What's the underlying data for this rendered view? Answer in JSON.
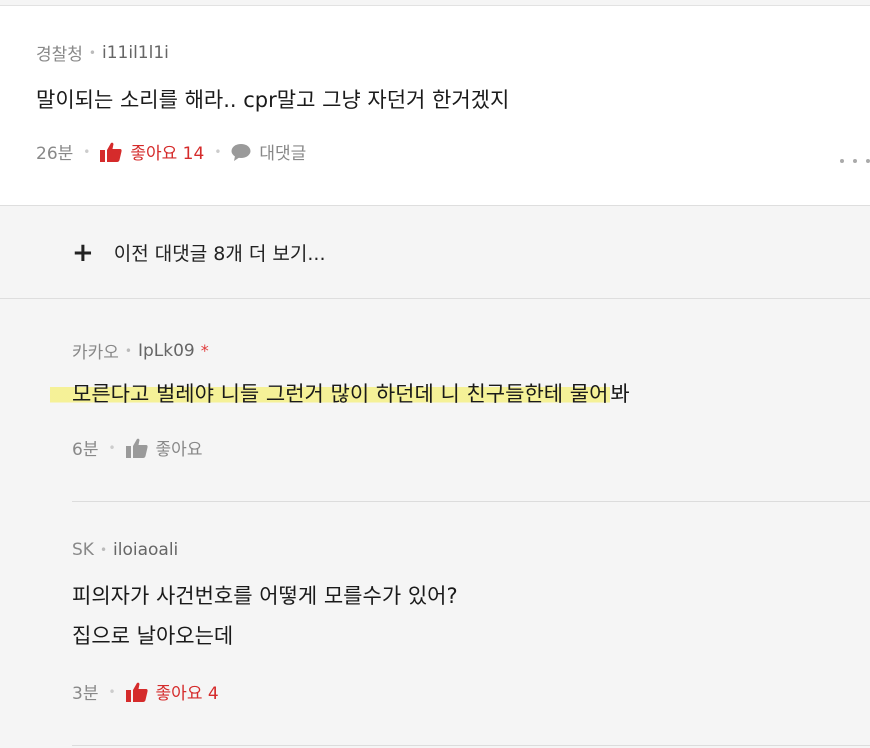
{
  "comment": {
    "source": "경찰청",
    "user": "i11il1l1i",
    "text": "말이되는 소리를 해라.. cpr말고 그냥 자던거 한거겠지",
    "time": "26분",
    "like_label": "좋아요 14",
    "reply_label": "대댓글"
  },
  "more_replies": {
    "label": "이전 대댓글 8개 더 보기..."
  },
  "replies": [
    {
      "source": "카카오",
      "user": "IpLk09",
      "badge": "*",
      "text_highlighted": "모른다고 벌레야 니들 그런거 많이 하던데 니 친구들한테 물어",
      "text_rest": "봐",
      "time": "6분",
      "like_label": "좋아요"
    },
    {
      "source": "SK",
      "user": "iloiaoali",
      "lines": [
        "피의자가 사건번호를 어떻게 모를수가 있어?",
        "집으로 날아오는데"
      ],
      "time": "3분",
      "like_label": "좋아요 4"
    }
  ],
  "colors": {
    "like_active": "#d52b2b",
    "highlight": "#f5f078",
    "muted": "#888888"
  }
}
